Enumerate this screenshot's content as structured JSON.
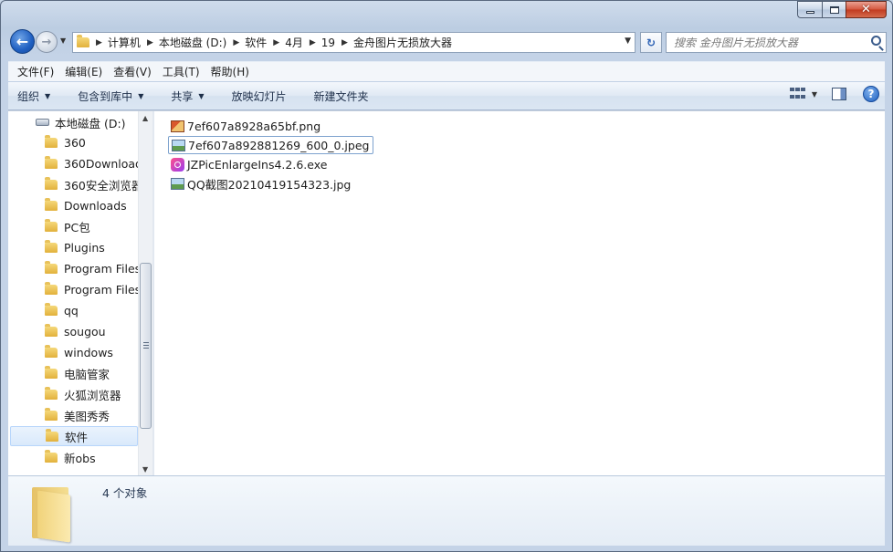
{
  "window": {
    "minimize_glyph": "—",
    "close_glyph": "✕"
  },
  "address": {
    "crumbs": [
      "计算机",
      "本地磁盘 (D:)",
      "软件",
      "4月",
      "19",
      "金舟图片无损放大器"
    ]
  },
  "search": {
    "placeholder": "搜索 金舟图片无损放大器"
  },
  "menu": [
    "文件(F)",
    "编辑(E)",
    "查看(V)",
    "工具(T)",
    "帮助(H)"
  ],
  "commands": {
    "organize": "组织",
    "include_in_library": "包含到库中",
    "share": "共享",
    "slideshow": "放映幻灯片",
    "new_folder": "新建文件夹",
    "help": "?"
  },
  "tree": {
    "root": "本地磁盘 (D:)",
    "items": [
      "360",
      "360Download",
      "360安全浏览器",
      "Downloads",
      "PC包",
      "Plugins",
      "Program Files",
      "Program Files",
      "qq",
      "sougou",
      "windows",
      "电脑管家",
      "火狐浏览器",
      "美图秀秀",
      "软件",
      "新obs"
    ],
    "selected_index": 14
  },
  "files": [
    {
      "name": "7ef607a8928a65bf.png",
      "icon": "png-file-icon"
    },
    {
      "name": "7ef607a892881269_600_0.jpeg",
      "icon": "image-file-icon"
    },
    {
      "name": "JZPicEnlargeIns4.2.6.exe",
      "icon": "exe-app-icon"
    },
    {
      "name": "QQ截图20210419154323.jpg",
      "icon": "image-file-icon"
    }
  ],
  "details": {
    "count": "4 个对象"
  }
}
